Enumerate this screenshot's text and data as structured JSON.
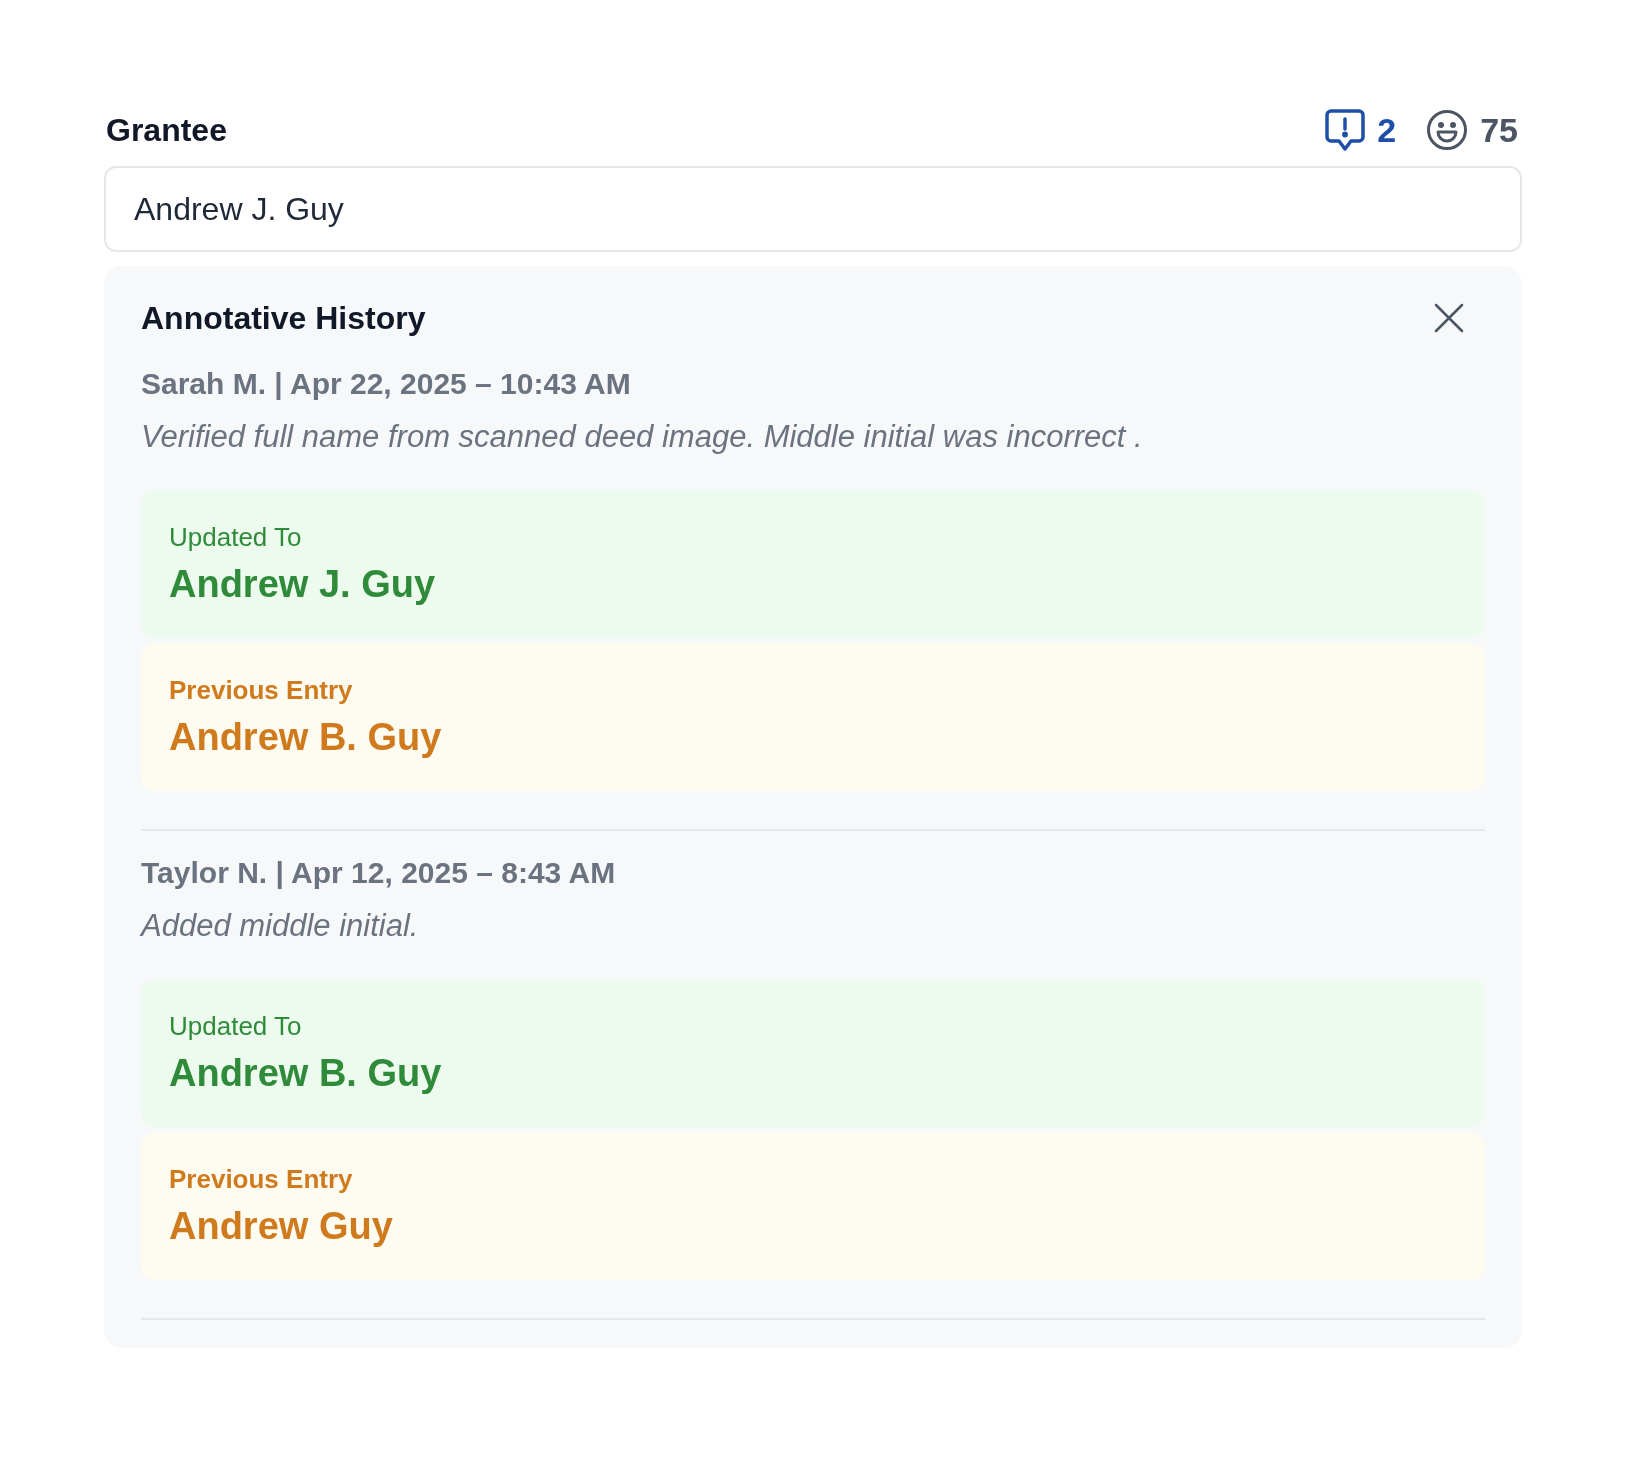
{
  "field": {
    "label": "Grantee",
    "value": "Andrew J. Guy",
    "comment_count": "2",
    "score": "75"
  },
  "history": {
    "title": "Annotative History",
    "entries": [
      {
        "header": "Sarah M. | Apr 22, 2025 – 10:43 AM",
        "comment": "Verified full name from scanned deed image. Middle initial was incorrect .",
        "changes": [
          {
            "kind": "updated",
            "label": "Updated To",
            "value": "Andrew J. Guy"
          },
          {
            "kind": "previous",
            "label": "Previous Entry",
            "value": "Andrew B. Guy"
          }
        ]
      },
      {
        "header": "Taylor N. | Apr 12, 2025 – 8:43 AM",
        "comment": "Added middle initial.",
        "changes": [
          {
            "kind": "updated",
            "label": "Updated To",
            "value": "Andrew B. Guy"
          },
          {
            "kind": "previous",
            "label": "Previous Entry",
            "value": "Andrew Guy"
          }
        ]
      }
    ]
  }
}
